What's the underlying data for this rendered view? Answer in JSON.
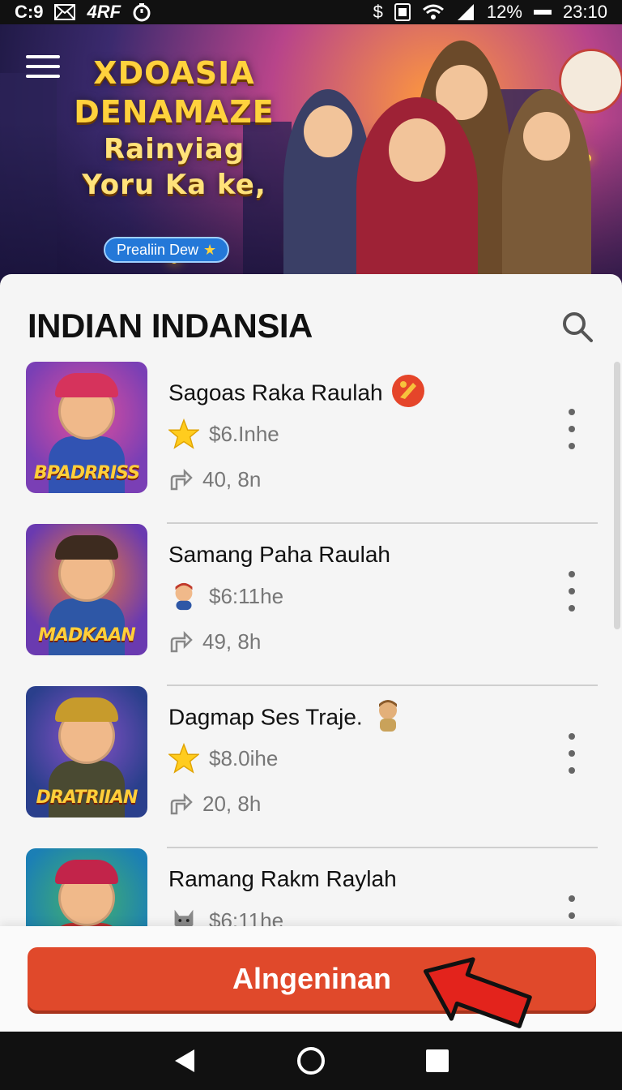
{
  "status_bar": {
    "left_text": "C:9",
    "left_icon2": "4RF",
    "battery": "12%",
    "time": "23:10",
    "icons": [
      "mail-icon",
      "timer-icon",
      "dollar-icon",
      "sim-icon",
      "wifi-icon",
      "signal-icon",
      "battery-icon"
    ]
  },
  "banner": {
    "title_line1": "XDOASIA",
    "title_line2": "DENAMAZE",
    "title_line3": "Rainyiag",
    "title_line4": "Yoru Ka ke,",
    "badge": "Prealiin Dew",
    "badge_icon": "star-icon"
  },
  "section": {
    "title": "INDIAN INDANSIA",
    "search_icon": "search-icon"
  },
  "items": [
    {
      "title": "Sagoas Raka Raulah",
      "price": "$6.Inhe",
      "stat": "40, 8n",
      "thumb_text": "BPADRRISS",
      "emblem": "badge-icon",
      "rating_icon": "star-icon",
      "colors": {
        "bg": "#7a3fb5",
        "bg2": "#e24f9c",
        "hat": "#d6335c",
        "body": "#3153b3"
      }
    },
    {
      "title": "Samang Paha Raulah",
      "price": "$6:11he",
      "stat": "49, 8h",
      "thumb_text": "MADKAAN",
      "emblem": "",
      "rating_icon": "avatar-icon",
      "colors": {
        "bg": "#6a3ab0",
        "bg2": "#f07a3a",
        "hat": "#3d2b1f",
        "body": "#2e57a6"
      }
    },
    {
      "title": "Dagmap Ses Traje.",
      "price": "$8.0ihe",
      "stat": "20, 8h",
      "thumb_text": "DRATRIIAN",
      "emblem": "figure-icon",
      "rating_icon": "star-icon",
      "colors": {
        "bg": "#2a3f8c",
        "bg2": "#8a52c8",
        "hat": "#c79b2c",
        "body": "#4a4a32"
      }
    },
    {
      "title": "Ramang Rakm Raylah",
      "price": "$6:11he",
      "stat": "",
      "thumb_text": "",
      "emblem": "",
      "rating_icon": "cat-icon",
      "colors": {
        "bg": "#1b7fb5",
        "bg2": "#45b36a",
        "hat": "#c2244a",
        "body": "#b83232"
      }
    }
  ],
  "cta": {
    "label": "Alngeninan"
  },
  "nav": {
    "back_icon": "back-icon",
    "home_icon": "home-icon",
    "recents_icon": "recents-icon"
  },
  "colors": {
    "accent": "#e0492b",
    "star": "#ffcc1e",
    "banner_title": "#ffd23d"
  }
}
